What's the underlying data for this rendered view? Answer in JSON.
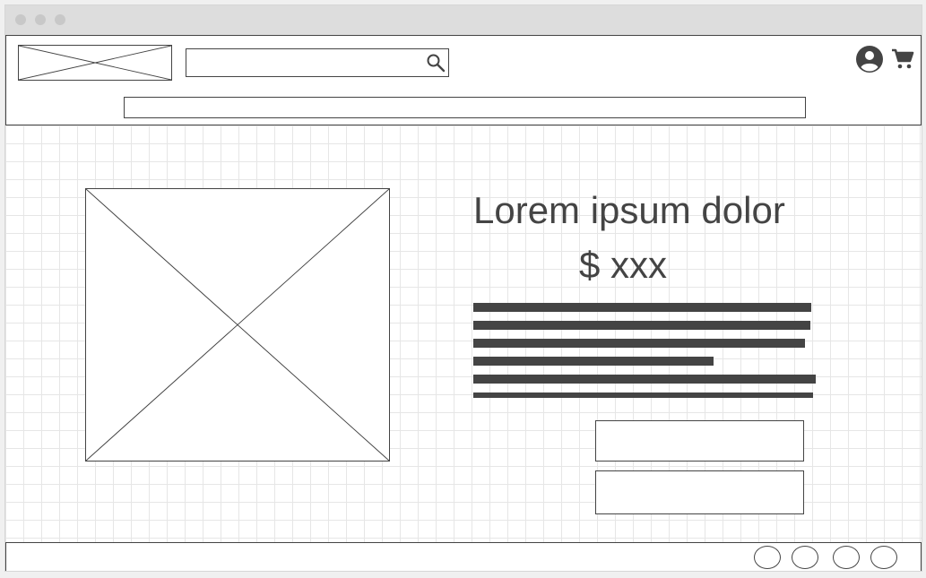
{
  "window": {
    "controls": [
      "close-dot",
      "minimize-dot",
      "maximize-dot"
    ]
  },
  "header": {
    "logo": "image-placeholder",
    "search": {
      "value": "",
      "placeholder": "",
      "icon": "search-icon"
    },
    "icons": [
      "account-icon",
      "cart-icon"
    ]
  },
  "product": {
    "image": "image-placeholder",
    "title": "Lorem ipsum dolor",
    "price": "$ xxx",
    "description_lines": 6
  },
  "footer": {
    "social_icons": 4
  },
  "colors": {
    "stroke": "#444444",
    "background": "#ffffff",
    "grid": "#e6e6e6",
    "titlebar": "#dddddd",
    "window_dot": "#c8c8c8"
  }
}
